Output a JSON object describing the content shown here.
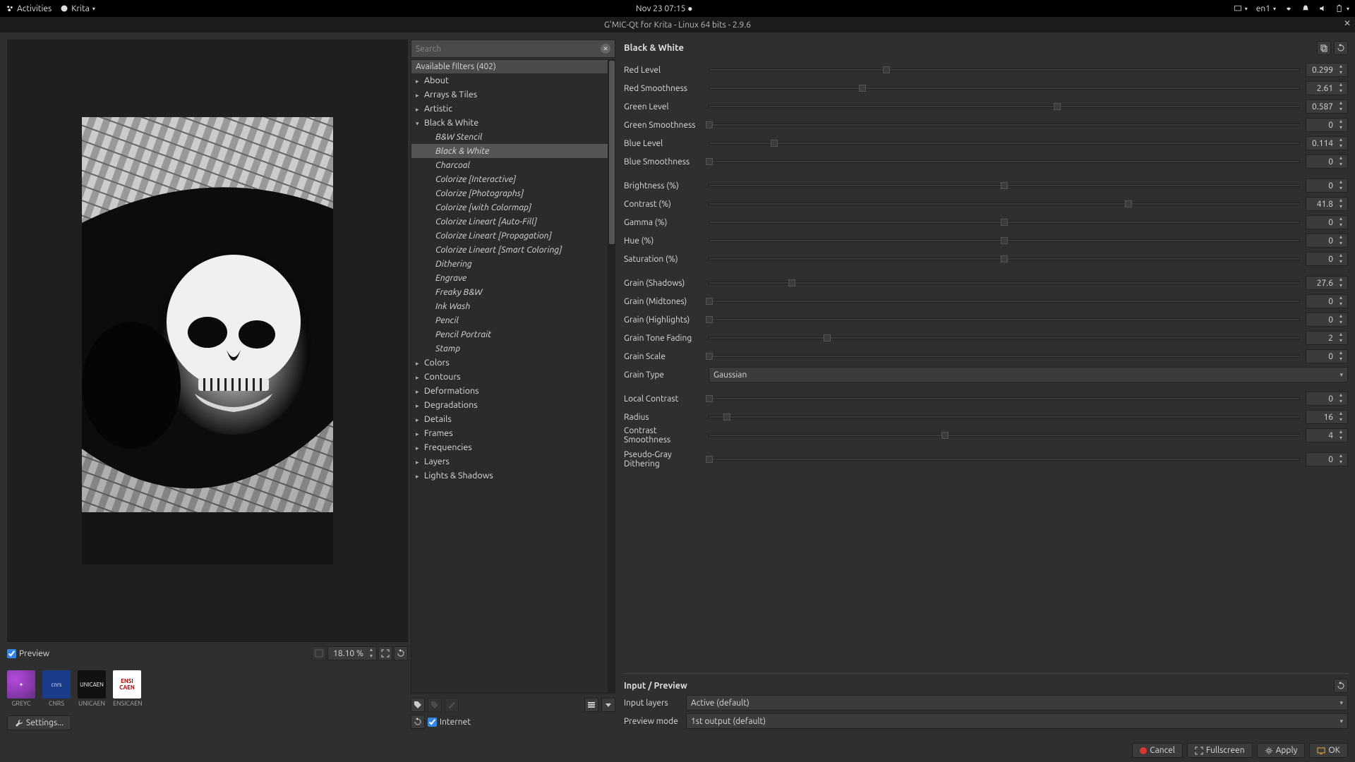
{
  "topbar": {
    "activities": "Activities",
    "app": "Krita",
    "datetime": "Nov 23  07:15",
    "lang": "en1"
  },
  "window": {
    "title": "G'MIC-Qt for Krita - Linux 64 bits - 2.9.6"
  },
  "preview": {
    "checkbox": "Preview",
    "zoom": "18.10 %"
  },
  "logos": [
    "GREYC",
    "CNRS",
    "UNICAEN",
    "ENSICAEN"
  ],
  "settings_btn": "Settings...",
  "search": {
    "placeholder": "Search"
  },
  "tree": {
    "header": "Available filters (402)",
    "categories_a": [
      "About",
      "Arrays & Tiles",
      "Artistic"
    ],
    "bw_label": "Black & White",
    "bw_children": [
      "B&W Stencil",
      "Black & White",
      "Charcoal",
      "Colorize [Interactive]",
      "Colorize [Photographs]",
      "Colorize [with Colormap]",
      "Colorize Lineart [Auto-Fill]",
      "Colorize Lineart [Propagation]",
      "Colorize Lineart [Smart Coloring]",
      "Dithering",
      "Engrave",
      "Freaky B&W",
      "Ink Wash",
      "Pencil",
      "Pencil Portrait",
      "Stamp"
    ],
    "categories_b": [
      "Colors",
      "Contours",
      "Deformations",
      "Degradations",
      "Details",
      "Frames",
      "Frequencies",
      "Layers",
      "Lights & Shadows"
    ]
  },
  "internet": "Internet",
  "panel": {
    "title": "Black & White",
    "params": [
      {
        "label": "Red Level",
        "value": "0.299",
        "pct": 30
      },
      {
        "label": "Red Smoothness",
        "value": "2.61",
        "pct": 26
      },
      {
        "label": "Green Level",
        "value": "0.587",
        "pct": 59
      },
      {
        "label": "Green Smoothness",
        "value": "0",
        "pct": 0
      },
      {
        "label": "Blue Level",
        "value": "0.114",
        "pct": 11
      },
      {
        "label": "Blue Smoothness",
        "value": "0",
        "pct": 0
      }
    ],
    "params2": [
      {
        "label": "Brightness (%)",
        "value": "0",
        "pct": 50
      },
      {
        "label": "Contrast (%)",
        "value": "41.8",
        "pct": 71
      },
      {
        "label": "Gamma (%)",
        "value": "0",
        "pct": 50
      },
      {
        "label": "Hue (%)",
        "value": "0",
        "pct": 50
      },
      {
        "label": "Saturation (%)",
        "value": "0",
        "pct": 50
      }
    ],
    "params3": [
      {
        "label": "Grain (Shadows)",
        "value": "27.6",
        "pct": 14
      },
      {
        "label": "Grain (Midtones)",
        "value": "0",
        "pct": 0
      },
      {
        "label": "Grain (Highlights)",
        "value": "0",
        "pct": 0
      },
      {
        "label": "Grain Tone Fading",
        "value": "2",
        "pct": 20
      },
      {
        "label": "Grain Scale",
        "value": "0",
        "pct": 0
      }
    ],
    "grain_type_label": "Grain Type",
    "grain_type_value": "Gaussian",
    "params4": [
      {
        "label": "Local Contrast",
        "value": "0",
        "pct": 0
      },
      {
        "label": "Radius",
        "value": "16",
        "pct": 3
      },
      {
        "label": "Contrast Smoothness",
        "value": "4",
        "pct": 40
      }
    ],
    "params5": [
      {
        "label": "Pseudo-Gray Dithering",
        "value": "0",
        "pct": 0
      }
    ]
  },
  "io": {
    "title": "Input / Preview",
    "input_label": "Input layers",
    "input_value": "Active (default)",
    "preview_label": "Preview mode",
    "preview_value": "1st output (default)"
  },
  "buttons": {
    "cancel": "Cancel",
    "fullscreen": "Fullscreen",
    "apply": "Apply",
    "ok": "OK"
  }
}
